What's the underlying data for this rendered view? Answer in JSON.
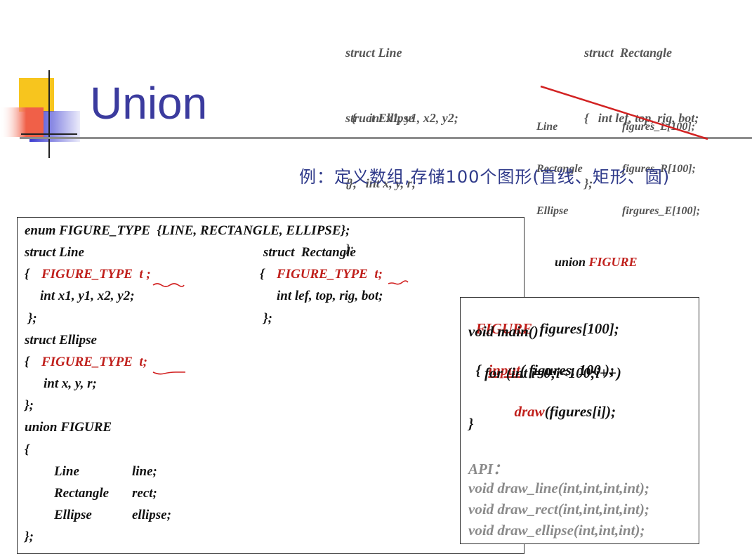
{
  "title": "Union",
  "subtitle": "例：定义数组,存储100个图形(直线、矩形、圆)",
  "top_code": {
    "line_struct": [
      "struct Line",
      "  {    int x1, y1, x2, y2;",
      " };"
    ],
    "ellipse_struct": [
      "struct Ellipse",
      "{     int x, y, r;",
      "};"
    ],
    "rect_struct": [
      "struct  Rectangle",
      "{   int lef, top, rig, bot;",
      "};"
    ],
    "crossed_types": [
      "Line",
      "Rectangle",
      "Ellipse"
    ],
    "crossed_arrays": [
      "figures_L[100];",
      "figures_R[100];",
      "firgures_E[100];"
    ]
  },
  "box1": {
    "enum_line": "enum FIGURE_TYPE  {LINE, RECTANGLE, ELLIPSE};",
    "struct_line": "struct Line",
    "struct_rect": "struct  Rectangle",
    "open_brace": "{",
    "figure_type_t1": "FIGURE_TYPE  t ;",
    "figure_type_t2": "FIGURE_TYPE  t;",
    "line_fields": "int x1, y1, x2, y2;",
    "rect_fields": "int lef, top, rig, bot;",
    "close1": " };",
    "close2": "};",
    "struct_ellipse": "struct Ellipse",
    "figure_type_t3": "FIGURE_TYPE  t;",
    "ellipse_fields": "int x, y, r;",
    "close3": "};",
    "union_line": "union FIGURE",
    "union_open": "{",
    "members": [
      {
        "type": "Line",
        "name": "line;"
      },
      {
        "type": "Rectangle",
        "name": "rect;"
      },
      {
        "type": "Ellipse",
        "name": "ellipse;"
      }
    ],
    "union_close": "};"
  },
  "union_snippet": {
    "keyword": "union ",
    "name": "FIGURE",
    "open": "{",
    "dots": ".........",
    "close": "};"
  },
  "box2": {
    "decl_type": "FIGURE",
    "decl_rest": "  figures[100];",
    "main_sig": "void main()",
    "brace_open": "{  ",
    "input_fn": "input",
    "input_args": "( figures, 100 );",
    "for_line": "for (int i=0;i<100;i++)",
    "draw_fn": "draw",
    "draw_args": "(figures[i]);",
    "brace_close": "}",
    "api_label": "API：",
    "api_lines": [
      "void draw_line(int,int,int,int);",
      "void draw_rect(int,int,int,int);",
      "void draw_ellipse(int,int,int);"
    ]
  },
  "colors": {
    "title": "#3b3b9e",
    "subtitle": "#2f3a8a",
    "keyword_red": "#c0201c",
    "api_gray": "#8a8a8a",
    "logo_yellow": "#f7c51e",
    "logo_blue": "#3a3ad0",
    "logo_red": "#f06048"
  }
}
